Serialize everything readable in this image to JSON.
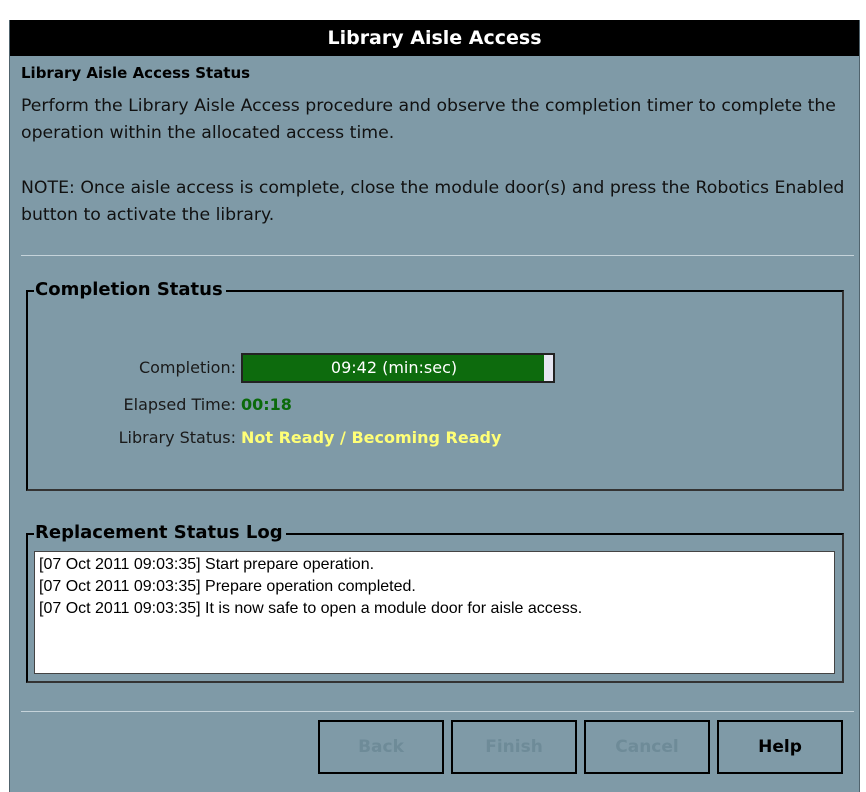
{
  "window": {
    "title": "Library Aisle Access"
  },
  "section": {
    "heading": "Library Aisle Access Status",
    "description": "Perform the Library Aisle Access procedure and observe the completion timer to complete the operation within the allocated access time.",
    "note": "NOTE: Once aisle access is complete, close the module door(s) and press the Robotics Enabled button to activate the library."
  },
  "completion_status": {
    "title": "Completion Status",
    "completion_label": "Completion:",
    "completion_value": "09:42 (min:sec)",
    "progress_fraction": 0.97,
    "elapsed_label": "Elapsed Time:",
    "elapsed_value": "00:18",
    "library_status_label": "Library Status:",
    "library_status_value": "Not Ready / Becoming Ready"
  },
  "log": {
    "title": "Replacement Status Log",
    "entries": [
      "[07 Oct 2011 09:03:35] Start prepare operation.",
      "[07 Oct 2011 09:03:35] Prepare operation completed.",
      "[07 Oct 2011 09:03:35] It is now safe to open a module door for aisle access."
    ]
  },
  "buttons": {
    "back": "Back",
    "finish": "Finish",
    "cancel": "Cancel",
    "help": "Help"
  },
  "colors": {
    "panel_background": "#7f9aa7",
    "progress_fill": "#0d6b0d",
    "elapsed_value": "#0b6a0b",
    "status_value": "#ffff77"
  }
}
